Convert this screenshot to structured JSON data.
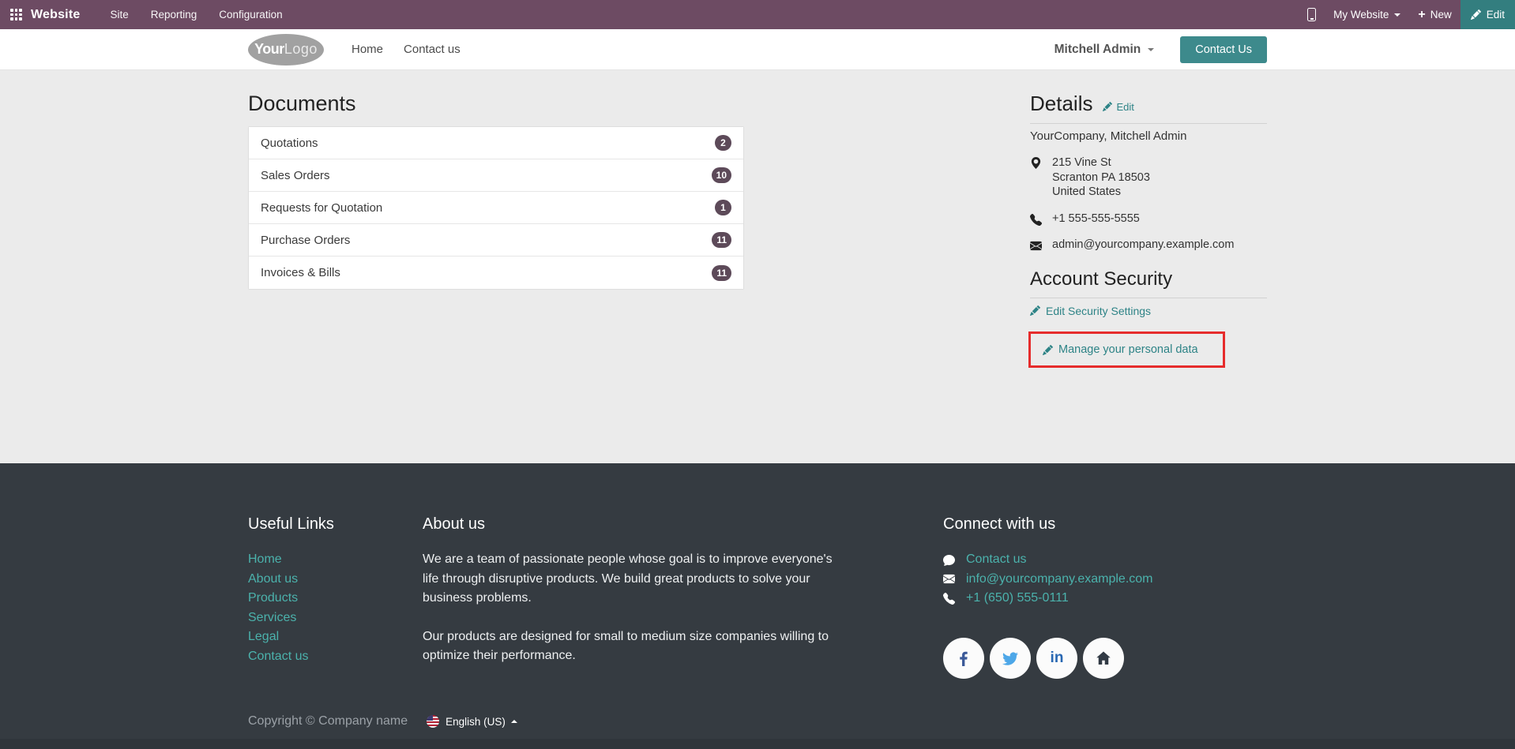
{
  "topbar": {
    "app_name": "Website",
    "menus": [
      "Site",
      "Reporting",
      "Configuration"
    ],
    "website_switcher": "My Website",
    "new_label": "New",
    "edit_label": "Edit"
  },
  "header": {
    "logo": {
      "your": "Your",
      "logo": "Logo"
    },
    "nav": [
      "Home",
      "Contact us"
    ],
    "user_name": "Mitchell Admin",
    "contact_button": "Contact Us"
  },
  "main": {
    "documents": {
      "title": "Documents",
      "items": [
        {
          "label": "Quotations",
          "count": "2"
        },
        {
          "label": "Sales Orders",
          "count": "10"
        },
        {
          "label": "Requests for Quotation",
          "count": "1"
        },
        {
          "label": "Purchase Orders",
          "count": "11"
        },
        {
          "label": "Invoices & Bills",
          "count": "11"
        }
      ]
    },
    "details": {
      "title": "Details",
      "edit_label": "Edit",
      "company_line": "YourCompany, Mitchell Admin",
      "address_lines": [
        "215 Vine St",
        "Scranton PA 18503",
        "United States"
      ],
      "phone": "+1 555-555-5555",
      "email": "admin@yourcompany.example.com"
    },
    "security": {
      "title": "Account Security",
      "edit_security_label": "Edit Security Settings",
      "manage_data_label": "Manage your personal data"
    }
  },
  "footer": {
    "useful_links": {
      "title": "Useful Links",
      "links": [
        "Home",
        "About us",
        "Products",
        "Services",
        "Legal",
        "Contact us"
      ]
    },
    "about": {
      "title": "About us",
      "paragraph1": "We are a team of passionate people whose goal is to improve everyone's life through disruptive products. We build great products to solve your business problems.",
      "paragraph2": "Our products are designed for small to medium size companies willing to optimize their performance."
    },
    "connect": {
      "title": "Connect with us",
      "contact_link": "Contact us",
      "email": "info@yourcompany.example.com",
      "phone": "+1 (650) 555-0111"
    },
    "copyright": "Copyright © Company name",
    "language": "English (US)"
  },
  "colors": {
    "topbar_bg": "#6d4b63",
    "accent_teal": "#3d8a8c",
    "link_teal": "#2d8386",
    "footer_link_teal": "#4bb2ac",
    "badge_bg": "#5d4a59",
    "footer_bg": "#353b41",
    "annotation_red": "#e62c2c"
  }
}
